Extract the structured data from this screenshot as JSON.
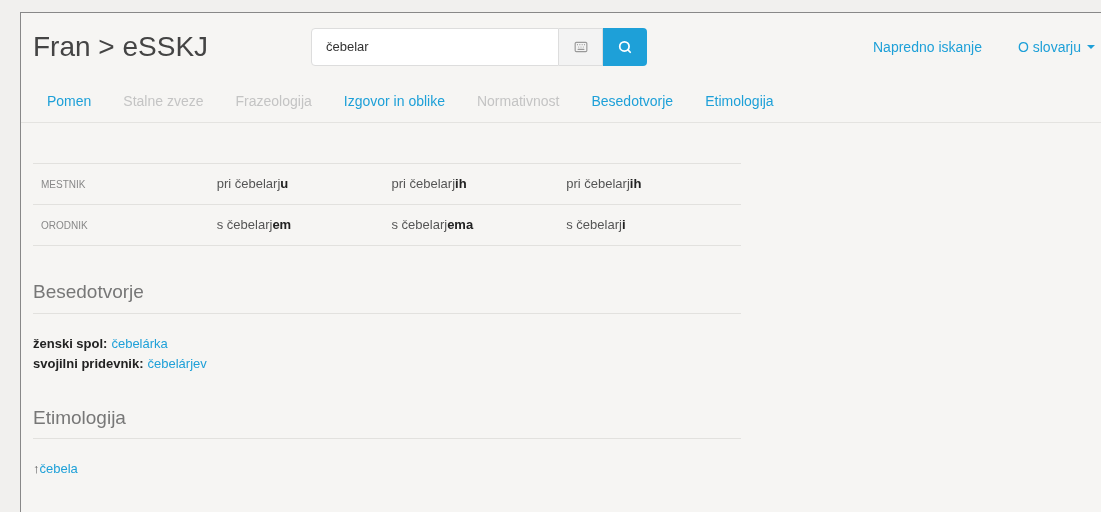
{
  "brand": "Fran > eSSKJ",
  "search": {
    "value": "čebelar"
  },
  "nav": [
    "Napredno iskanje",
    "O slovarju"
  ],
  "tabs": [
    {
      "label": "Pomen",
      "disabled": false
    },
    {
      "label": "Stalne zveze",
      "disabled": true
    },
    {
      "label": "Frazeologija",
      "disabled": true
    },
    {
      "label": "Izgovor in oblike",
      "disabled": false
    },
    {
      "label": "Normativnost",
      "disabled": true
    },
    {
      "label": "Besedotvorje",
      "disabled": false
    },
    {
      "label": "Etimologija",
      "disabled": false
    }
  ],
  "table": {
    "rows": [
      {
        "label": "MESTNIK",
        "cells": [
          "pri čebelarj**u**",
          "pri čebelarj**ih**",
          "pri čebelarj**ih**"
        ]
      },
      {
        "label": "ORODNIK",
        "cells": [
          "s čebelarj**em**",
          "s čebelarj**ema**",
          "s čebelarj**i**"
        ]
      }
    ]
  },
  "besedotvorje": {
    "title": "Besedotvorje",
    "items": [
      {
        "label": "ženski spol:",
        "link": "čebelárka"
      },
      {
        "label": "svojilni pridevnik:",
        "link": "čebelárjev"
      }
    ]
  },
  "etimologija": {
    "title": "Etimologija",
    "arrow": "↑",
    "link": "čebela"
  }
}
